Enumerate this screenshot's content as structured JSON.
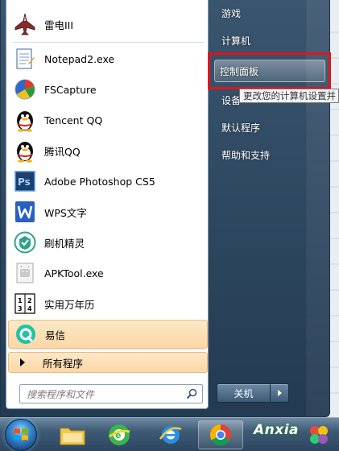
{
  "background_window": {
    "fragments": [
      "",
      "",
      "",
      "",
      "",
      "",
      "",
      "",
      "",
      "",
      "",
      "",
      "",
      "",
      ""
    ]
  },
  "start_menu": {
    "pinned": [
      {
        "label": "雷电III",
        "icon": "raiden-jet-icon"
      },
      {
        "label": "Notepad2.exe",
        "icon": "notepad-icon"
      },
      {
        "label": "FSCapture",
        "icon": "fscapture-icon"
      },
      {
        "label": "Tencent QQ",
        "icon": "qq-penguin-icon"
      },
      {
        "label": "腾讯QQ",
        "icon": "qq-penguin-icon"
      },
      {
        "label": "Adobe Photoshop CS5",
        "icon": "photoshop-icon"
      },
      {
        "label": "WPS文字",
        "icon": "wps-writer-icon"
      },
      {
        "label": "刷机精灵",
        "icon": "shuaji-jingling-icon"
      },
      {
        "label": "APKTool.exe",
        "icon": "apktool-icon"
      },
      {
        "label": "实用万年历",
        "icon": "calendar-icon"
      },
      {
        "label": "易信",
        "icon": "yixin-icon"
      }
    ],
    "all_programs": "所有程序",
    "search_placeholder": "搜索程序和文件",
    "right_items": [
      {
        "label": "游戏"
      },
      {
        "label": "计算机"
      },
      {
        "label": "控制面板"
      },
      {
        "label": "设备"
      },
      {
        "label": "默认程序"
      },
      {
        "label": "帮助和支持"
      }
    ],
    "tooltip": "更改您的计算机设置并",
    "shutdown_label": "关机"
  },
  "taskbar": {
    "watermark": "Anxia"
  },
  "colors": {
    "highlight_red": "#e0151b",
    "hover_orange": "#fbd7a5"
  }
}
